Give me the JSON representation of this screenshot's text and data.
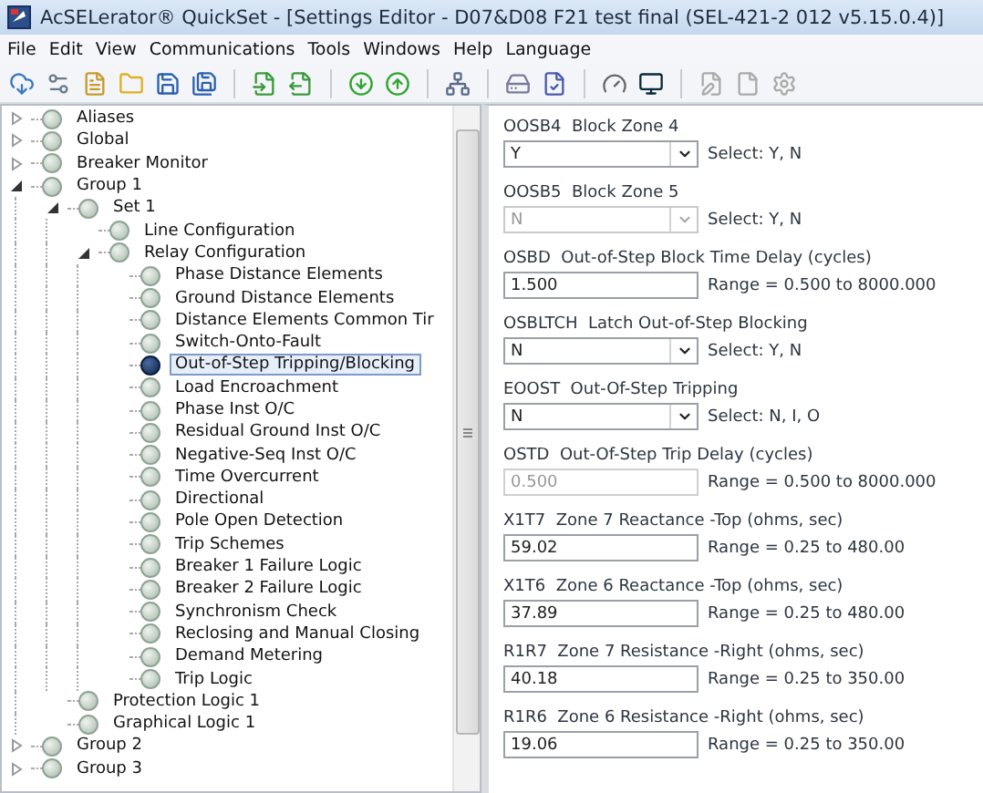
{
  "window": {
    "title": "AcSELerator® QuickSet - [Settings Editor - D07&D08 F21 test  final (SEL-421-2 012 v5.15.0.4)]"
  },
  "menu": [
    "File",
    "Edit",
    "View",
    "Communications",
    "Tools",
    "Windows",
    "Help",
    "Language"
  ],
  "tree": [
    {
      "label": "Aliases",
      "expanded": false,
      "selected": false
    },
    {
      "label": "Global",
      "expanded": false,
      "selected": false
    },
    {
      "label": "Breaker Monitor",
      "expanded": false,
      "selected": false
    },
    {
      "label": "Group 1",
      "expanded": true,
      "selected": false,
      "children": [
        {
          "label": "Set 1",
          "expanded": true,
          "selected": false,
          "children": [
            {
              "label": "Line Configuration",
              "selected": false
            },
            {
              "label": "Relay Configuration",
              "expanded": true,
              "selected": false,
              "children": [
                {
                  "label": "Phase Distance Elements",
                  "selected": false
                },
                {
                  "label": "Ground Distance Elements",
                  "selected": false
                },
                {
                  "label": "Distance Elements Common Tir",
                  "selected": false
                },
                {
                  "label": "Switch-Onto-Fault",
                  "selected": false
                },
                {
                  "label": "Out-of-Step Tripping/Blocking",
                  "selected": true
                },
                {
                  "label": "Load Encroachment",
                  "selected": false
                },
                {
                  "label": "Phase Inst O/C",
                  "selected": false
                },
                {
                  "label": "Residual Ground Inst O/C",
                  "selected": false
                },
                {
                  "label": "Negative-Seq Inst O/C",
                  "selected": false
                },
                {
                  "label": "Time Overcurrent",
                  "selected": false
                },
                {
                  "label": "Directional",
                  "selected": false
                },
                {
                  "label": "Pole Open Detection",
                  "selected": false
                },
                {
                  "label": "Trip Schemes",
                  "selected": false
                },
                {
                  "label": "Breaker 1 Failure Logic",
                  "selected": false
                },
                {
                  "label": "Breaker 2 Failure Logic",
                  "selected": false
                },
                {
                  "label": "Synchronism Check",
                  "selected": false
                },
                {
                  "label": "Reclosing and Manual Closing",
                  "selected": false
                },
                {
                  "label": "Demand Metering",
                  "selected": false
                },
                {
                  "label": "Trip Logic",
                  "selected": false
                }
              ]
            }
          ]
        },
        {
          "label": "Protection Logic 1",
          "selected": false
        },
        {
          "label": "Graphical Logic 1",
          "selected": false
        }
      ]
    },
    {
      "label": "Group 2",
      "expanded": false,
      "selected": false
    },
    {
      "label": "Group 3",
      "expanded": false,
      "selected": false
    }
  ],
  "settings": [
    {
      "label": "OOSB4  Block Zone 4",
      "kind": "select",
      "value": "Y",
      "hint": "Select: Y, N",
      "disabled": false
    },
    {
      "label": "OOSB5  Block Zone 5",
      "kind": "select",
      "value": "N",
      "hint": "Select: Y, N",
      "disabled": true
    },
    {
      "label": "OSBD  Out-of-Step Block Time Delay (cycles)",
      "kind": "text",
      "value": "1.500",
      "hint": "Range = 0.500 to 8000.000",
      "disabled": false
    },
    {
      "label": "OSBLTCH  Latch Out-of-Step Blocking",
      "kind": "select",
      "value": "N",
      "hint": "Select: Y, N",
      "disabled": false
    },
    {
      "label": "EOOST  Out-Of-Step Tripping",
      "kind": "select",
      "value": "N",
      "hint": "Select: N, I, O",
      "disabled": false
    },
    {
      "label": "OSTD  Out-Of-Step Trip Delay (cycles)",
      "kind": "text",
      "value": "0.500",
      "hint": "Range = 0.500 to 8000.000",
      "disabled": true
    },
    {
      "label": "X1T7  Zone 7 Reactance -Top (ohms, sec)",
      "kind": "text",
      "value": "59.02",
      "hint": "Range = 0.25 to 480.00",
      "disabled": false
    },
    {
      "label": "X1T6  Zone 6 Reactance -Top (ohms, sec)",
      "kind": "text",
      "value": "37.89",
      "hint": "Range = 0.25 to 480.00",
      "disabled": false
    },
    {
      "label": "R1R7  Zone 7 Resistance -Right (ohms, sec)",
      "kind": "text",
      "value": "40.18",
      "hint": "Range = 0.25 to 350.00",
      "disabled": false
    },
    {
      "label": "R1R6  Zone 6 Resistance -Right (ohms, sec)",
      "kind": "text",
      "value": "19.06",
      "hint": "Range = 0.25 to 350.00",
      "disabled": false
    }
  ]
}
